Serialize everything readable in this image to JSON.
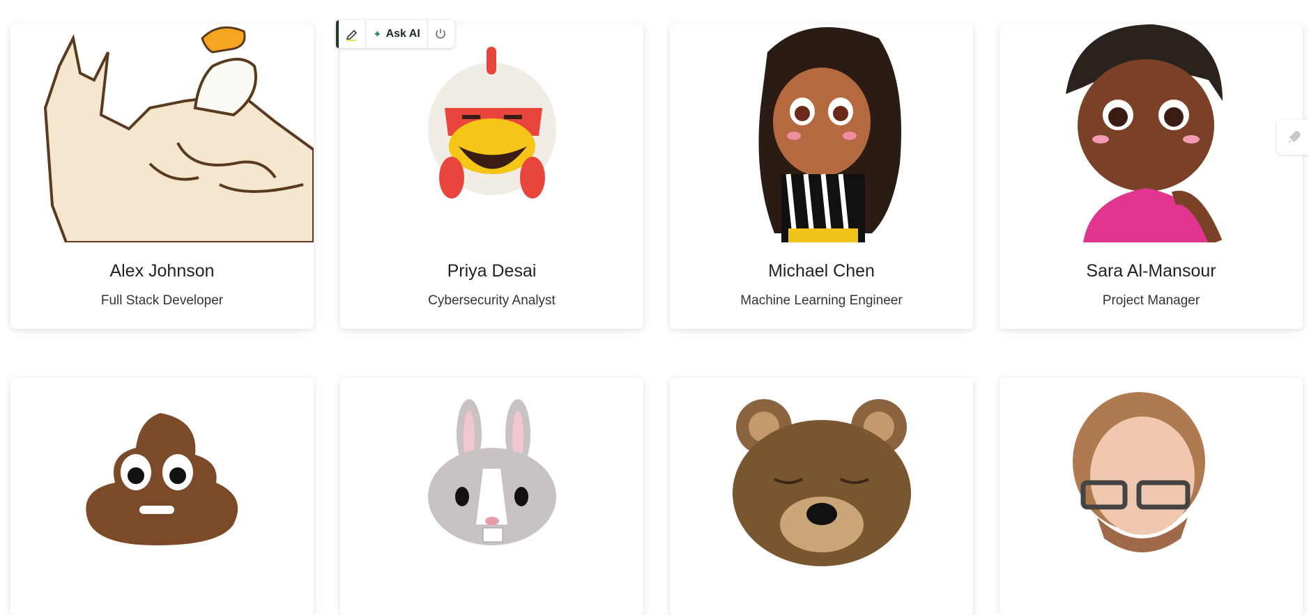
{
  "toolbar": {
    "ask_label": "Ask AI",
    "pen_icon": "highlighter-pen-icon",
    "power_icon": "power-icon"
  },
  "side_tab": {
    "icon": "rocket-icon"
  },
  "team": [
    {
      "name": "Alex Johnson",
      "role": "Full Stack Developer",
      "avatar": "muscular-eagle"
    },
    {
      "name": "Priya Desai",
      "role": "Cybersecurity Analyst",
      "avatar": "chicken-memoji"
    },
    {
      "name": "Michael Chen",
      "role": "Machine Learning Engineer",
      "avatar": "cartoon-girl-curly-hair"
    },
    {
      "name": "Sara Al-Mansour",
      "role": "Project Manager",
      "avatar": "cartoon-girl-short-hair"
    },
    {
      "name": "",
      "role": "",
      "avatar": "poop-emoji"
    },
    {
      "name": "",
      "role": "",
      "avatar": "rabbit-memoji"
    },
    {
      "name": "",
      "role": "",
      "avatar": "bear-memoji"
    },
    {
      "name": "",
      "role": "",
      "avatar": "bearded-man-memoji"
    }
  ]
}
